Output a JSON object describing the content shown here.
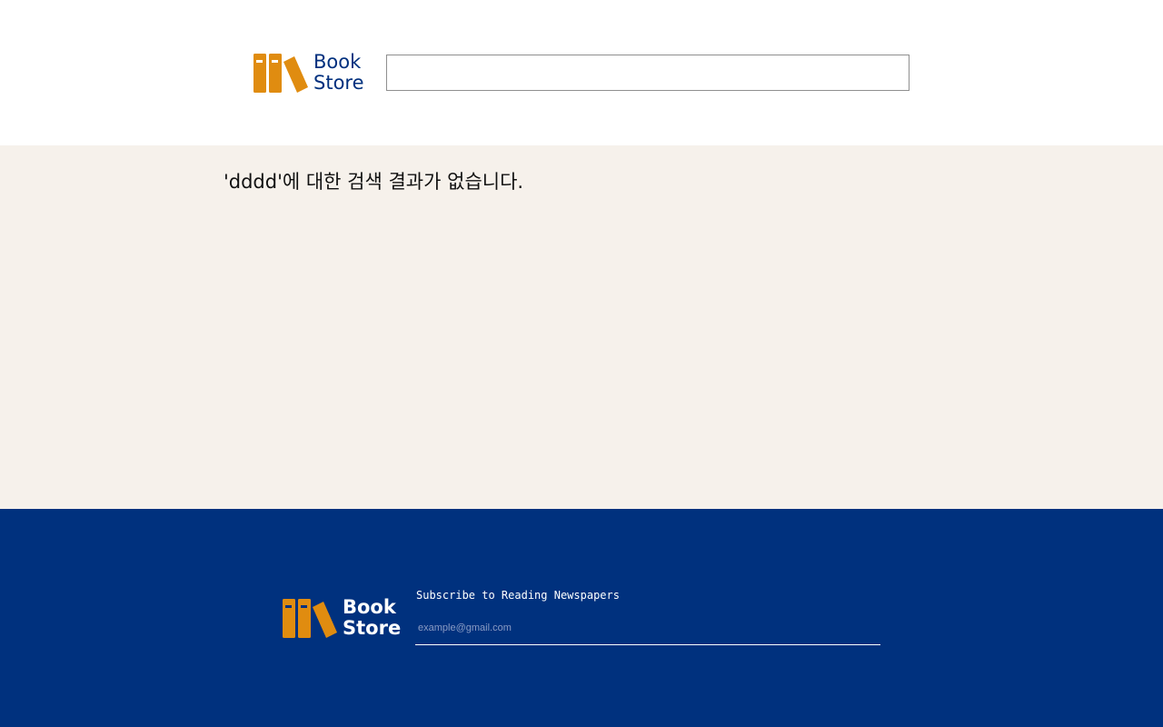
{
  "header": {
    "logo": {
      "line1": "Book",
      "line2": "Store"
    },
    "search": {
      "value": "",
      "placeholder": ""
    }
  },
  "main": {
    "message": "'dddd'에 대한 검색 결과가 없습니다."
  },
  "footer": {
    "logo": {
      "line1": "Book",
      "line2": "Store"
    },
    "subscribe_title": "Subscribe to Reading Newspapers",
    "email": {
      "value": "",
      "placeholder": "example@gmail.com"
    }
  },
  "colors": {
    "brand_navy": "#00317e",
    "logo_orange": "#e08c10",
    "main_bg": "#f6f1eb"
  }
}
